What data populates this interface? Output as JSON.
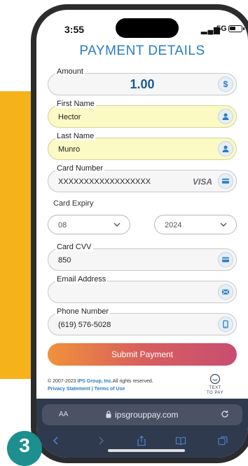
{
  "step_badge": "3",
  "status_bar": {
    "time": "3:55",
    "network": "5G"
  },
  "page_title": "PAYMENT DETAILS",
  "fields": {
    "amount": {
      "label": "Amount",
      "value": "1.00"
    },
    "first_name": {
      "label": "First Name",
      "value": "Hector"
    },
    "last_name": {
      "label": "Last Name",
      "value": "Munro"
    },
    "card_number": {
      "label": "Card Number",
      "value": "XXXXXXXXXXXXXXXXXX",
      "brand": "VISA"
    },
    "card_expiry": {
      "label": "Card Expiry",
      "month": "08",
      "year": "2024"
    },
    "card_cvv": {
      "label": "Card CVV",
      "value": "850"
    },
    "email": {
      "label": "Email Address",
      "value": ""
    },
    "phone": {
      "label": "Phone Number",
      "value": "(619) 576-5028"
    }
  },
  "submit_label": "Submit Payment",
  "footer": {
    "copyright_prefix": "© 2007-2023 ",
    "company": "IPS Group, Inc.",
    "copyright_suffix": "All rights reserved.",
    "privacy": "Privacy Statement",
    "separator": " | ",
    "terms": "Terms of Use"
  },
  "text_to_pay": {
    "line1": "TEXT",
    "line2": "TO PAY"
  },
  "browser": {
    "text_size": "AA",
    "url": "ipsgrouppay.com"
  },
  "colors": {
    "accent": "#2a7dc4",
    "field_highlight": "#fbf9c4",
    "badge": "#1d8f8f",
    "deco": "#f5b21a"
  }
}
